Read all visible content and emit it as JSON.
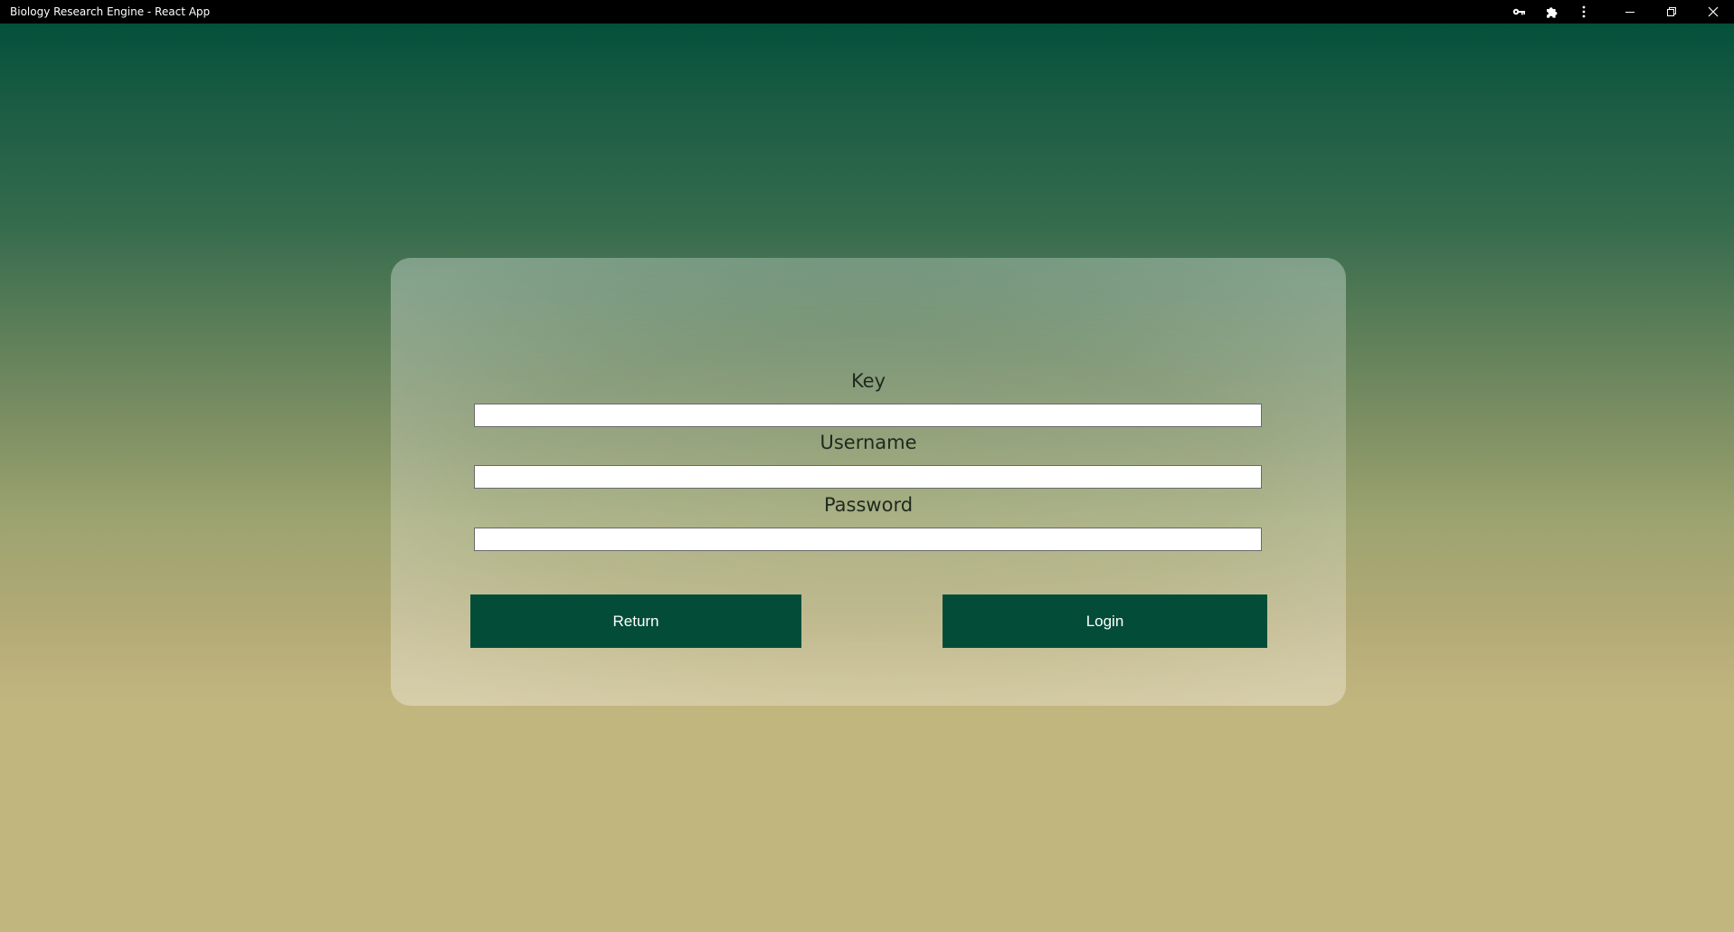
{
  "window": {
    "title": "Biology Research Engine - React App",
    "toolbar_icons": [
      "key-icon",
      "puzzle-extension-icon",
      "more-vertical-icon"
    ],
    "controls": [
      "minimize-icon",
      "restore-icon",
      "close-icon"
    ]
  },
  "form": {
    "key": {
      "label": "Key",
      "value": "",
      "placeholder": ""
    },
    "username": {
      "label": "Username",
      "value": "",
      "placeholder": ""
    },
    "password": {
      "label": "Password",
      "value": "",
      "placeholder": ""
    }
  },
  "buttons": {
    "return_label": "Return",
    "login_label": "Login"
  },
  "colors": {
    "gradient_top": "#04503a",
    "gradient_bottom": "#c2b67f",
    "button_bg": "#034d38",
    "button_text": "#ffffff"
  }
}
